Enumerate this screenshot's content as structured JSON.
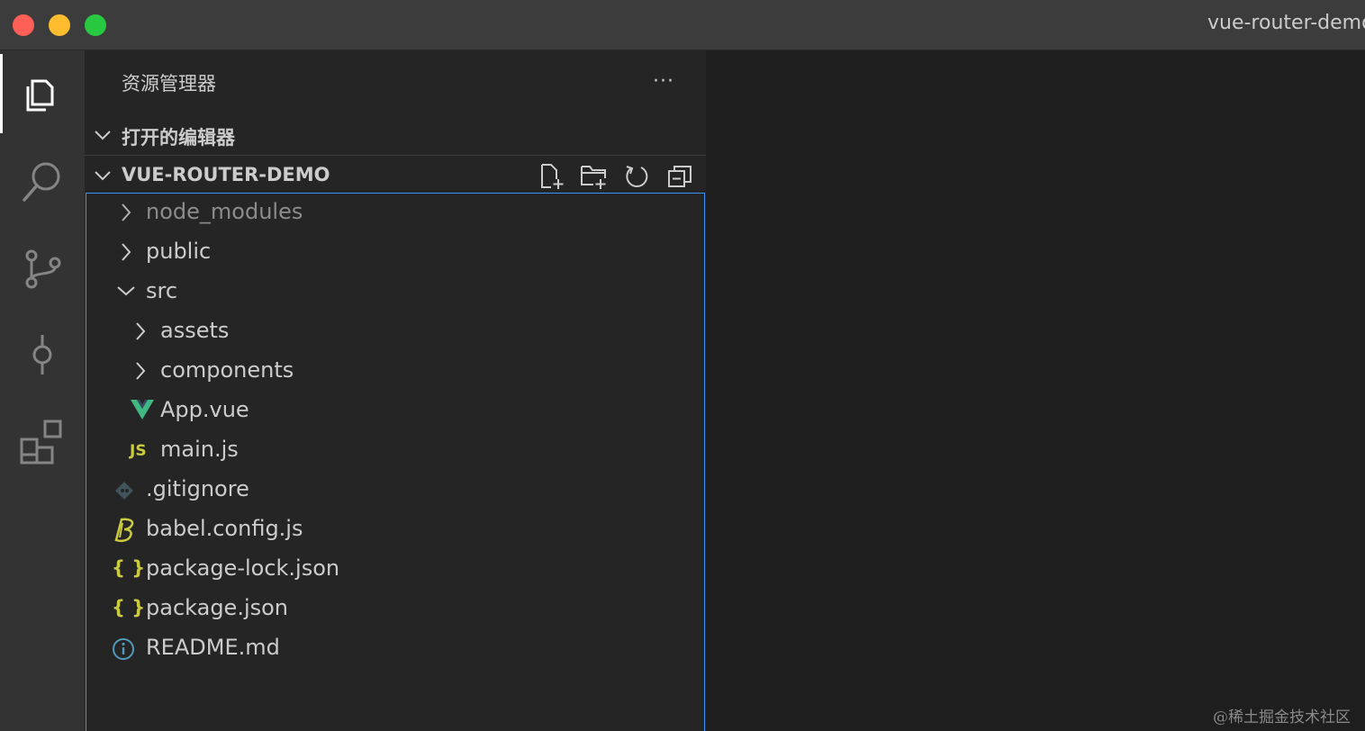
{
  "window": {
    "title": "vue-router-demo"
  },
  "activity_bar": {
    "items": [
      {
        "icon": "files-icon",
        "active": true
      },
      {
        "icon": "search-icon",
        "active": false
      },
      {
        "icon": "source-control-icon",
        "active": false
      },
      {
        "icon": "git-commit-icon",
        "active": false
      },
      {
        "icon": "extensions-icon",
        "active": false
      }
    ]
  },
  "sidebar": {
    "title": "资源管理器",
    "more": "···",
    "open_editors": {
      "label": "打开的编辑器",
      "expanded": false
    },
    "project": {
      "label": "VUE-ROUTER-DEMO",
      "expanded": true,
      "toolbar": [
        "new-file-icon",
        "new-folder-icon",
        "refresh-icon",
        "collapse-all-icon"
      ]
    },
    "tree": [
      {
        "label": "node_modules",
        "kind": "folder",
        "expanded": false,
        "depth": 0,
        "dimmed": true
      },
      {
        "label": "public",
        "kind": "folder",
        "expanded": false,
        "depth": 0
      },
      {
        "label": "src",
        "kind": "folder",
        "expanded": true,
        "depth": 0
      },
      {
        "label": "assets",
        "kind": "folder",
        "expanded": false,
        "depth": 1
      },
      {
        "label": "components",
        "kind": "folder",
        "expanded": false,
        "depth": 1
      },
      {
        "label": "App.vue",
        "kind": "vue-file",
        "depth": 1
      },
      {
        "label": "main.js",
        "kind": "js-file",
        "depth": 1
      },
      {
        "label": ".gitignore",
        "kind": "git-file",
        "depth": 0
      },
      {
        "label": "babel.config.js",
        "kind": "babel-file",
        "depth": 0
      },
      {
        "label": "package-lock.json",
        "kind": "json-file",
        "depth": 0
      },
      {
        "label": "package.json",
        "kind": "json-file",
        "depth": 0
      },
      {
        "label": "README.md",
        "kind": "info-file",
        "depth": 0
      }
    ],
    "icon_text": {
      "js": "JS",
      "json": "{ }"
    }
  },
  "watermark": "@稀土掘金技术社区",
  "colors": {
    "accent": "#3794ff",
    "vue": "#41b883",
    "js": "#cbcb41",
    "info": "#519aba"
  }
}
